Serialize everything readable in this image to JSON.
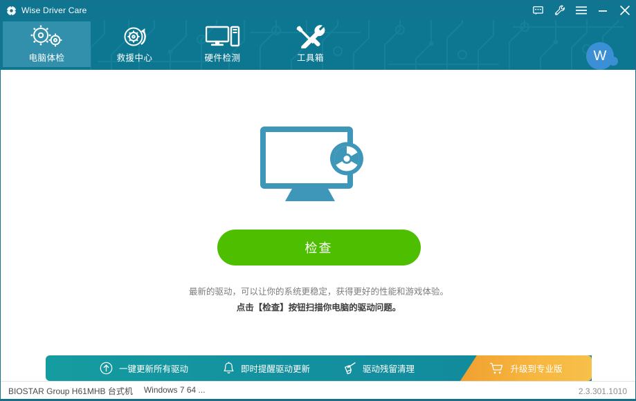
{
  "window": {
    "title": "Wise Driver Care",
    "logo_icon": "gear-icon",
    "controls": [
      {
        "name": "feedback-icon",
        "label": "Feedback"
      },
      {
        "name": "wrench-icon",
        "label": "Tools"
      },
      {
        "name": "menu-icon",
        "label": "Menu"
      },
      {
        "name": "minimize-icon",
        "label": "Minimize"
      },
      {
        "name": "close-icon",
        "label": "Close"
      }
    ]
  },
  "nav": {
    "tabs": [
      {
        "id": "pc-checkup",
        "label": "电脑体检",
        "icon": "gears-icon",
        "active": true
      },
      {
        "id": "rescue-center",
        "label": "救援中心",
        "icon": "gear-refresh-icon",
        "active": false
      },
      {
        "id": "hardware-detect",
        "label": "硬件检测",
        "icon": "monitor-pc-icon",
        "active": false
      },
      {
        "id": "toolbox",
        "label": "工具箱",
        "icon": "tools-icon",
        "active": false
      }
    ],
    "avatar": {
      "initial": "W",
      "color": "#3b8fd4"
    }
  },
  "main": {
    "hero_icon": "monitor-gear-icon",
    "scan_button": "检查",
    "description_line1": "最新的驱动，可以让你的系统更稳定，获得更好的性能和游戏体验。",
    "description_line2": "点击【检查】按钮扫描你电脑的驱动问题。",
    "scan_button_color": "#4ebf00"
  },
  "action_bar": {
    "items": [
      {
        "id": "update-all",
        "label": "一键更新所有驱动",
        "icon": "arrow-up-circle-icon"
      },
      {
        "id": "realtime-reminder",
        "label": "即时提醒驱动更新",
        "icon": "bell-icon"
      },
      {
        "id": "residue-cleanup",
        "label": "驱动残留清理",
        "icon": "brush-icon"
      }
    ],
    "upgrade": {
      "label": "升级到专业版",
      "icon": "cart-icon",
      "color": "#f5b13c"
    }
  },
  "status_bar": {
    "machine": "BIOSTAR Group H61MHB 台式机",
    "os": "Windows 7 64 ...",
    "version": "2.3.301.1010"
  }
}
